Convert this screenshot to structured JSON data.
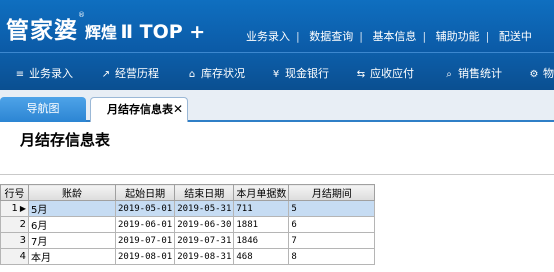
{
  "app": {
    "logo_main": "管家婆",
    "logo_reg": "®",
    "logo_sub": "辉煌",
    "logo_version": "Ⅱ TOP +",
    "top_menu": [
      "业务录入",
      "数据查询",
      "基本信息",
      "辅助功能",
      "配送中"
    ]
  },
  "nav": [
    {
      "icon": "≡",
      "label": "业务录入"
    },
    {
      "icon": "↗",
      "label": "经营历程"
    },
    {
      "icon": "⌂",
      "label": "库存状况"
    },
    {
      "icon": "¥",
      "label": "现金银行"
    },
    {
      "icon": "⇆",
      "label": "应收应付"
    },
    {
      "icon": "⌕",
      "label": "销售统计"
    },
    {
      "icon": "⚙",
      "label": "物"
    }
  ],
  "tabs": {
    "nav": "导航图",
    "active": "月结存信息表",
    "close": "✕"
  },
  "page_title": "月结存信息表",
  "table": {
    "headers": [
      "行号",
      "账龄",
      "起始日期",
      "结束日期",
      "本月单据数",
      "月结期间"
    ],
    "rows": [
      {
        "no": "1",
        "name": "5月",
        "start": "2019-05-01",
        "end": "2019-05-31",
        "count": "711",
        "period": "5"
      },
      {
        "no": "2",
        "name": "6月",
        "start": "2019-06-01",
        "end": "2019-06-30",
        "count": "1881",
        "period": "6"
      },
      {
        "no": "3",
        "name": "7月",
        "start": "2019-07-01",
        "end": "2019-07-31",
        "count": "1846",
        "period": "7"
      },
      {
        "no": "4",
        "name": "本月",
        "start": "2019-08-01",
        "end": "2019-08-31",
        "count": "468",
        "period": "8"
      }
    ]
  }
}
